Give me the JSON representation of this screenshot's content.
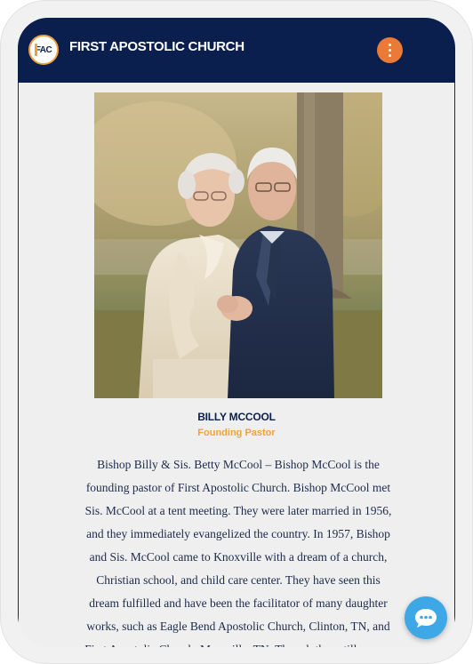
{
  "header": {
    "logo_text": "FAC",
    "title": "FIRST APOSTOLIC CHURCH",
    "menu_icon": "kebab-menu-icon"
  },
  "profile": {
    "name": "BILLY MCCOOL",
    "role": "Founding Pastor",
    "bio": "Bishop Billy & Sis. Betty McCool – Bishop McCool is the founding pastor of First Apostolic Church. Bishop McCool met Sis. McCool at a tent meeting. They were later married in 1956, and they immediately evangelized the country. In 1957, Bishop and Sis. McCool came to Knoxville with a dream of a church, Christian school, and child care center. They have seen this dream fulfilled and have been the facilitator of many daughter works, such as Eagle Bend Apostolic Church, Clinton, TN, and First Apostolic Church, Maryville, TN. Though they still pursue and serve"
  },
  "chat": {
    "icon": "chat-bubble-icon"
  },
  "colors": {
    "header_bg": "#0b1f4f",
    "accent": "#ea7a36",
    "role_color": "#f0a23a",
    "chat_button": "#3ea7e6"
  }
}
